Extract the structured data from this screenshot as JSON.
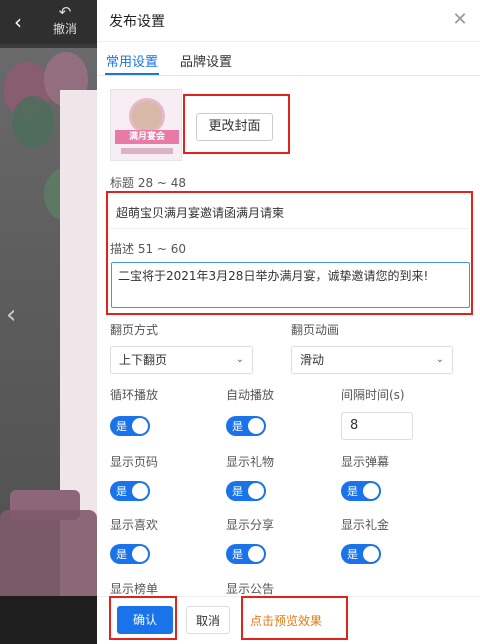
{
  "editor": {
    "undo_label": "撤消"
  },
  "panel": {
    "title": "发布设置",
    "tabs": [
      {
        "label": "常用设置",
        "active": true
      },
      {
        "label": "品牌设置",
        "active": false
      }
    ],
    "cover": {
      "banner_text": "满月宴会",
      "change_button": "更改封面"
    },
    "title_field": {
      "label": "标题 28 ~ 48",
      "value": "超萌宝贝满月宴邀请函满月请柬"
    },
    "desc_field": {
      "label": "描述 51 ~ 60",
      "value": "二宝将于2021年3月28日举办满月宴，诚挚邀请您的到来!"
    },
    "page_turn": {
      "mode_label": "翻页方式",
      "mode_value": "上下翻页",
      "anim_label": "翻页动画",
      "anim_value": "滑动"
    },
    "toggles": [
      {
        "label": "循环播放",
        "state": "是"
      },
      {
        "label": "自动播放",
        "state": "是"
      },
      {
        "label": "显示页码",
        "state": "是"
      },
      {
        "label": "显示礼物",
        "state": "是"
      },
      {
        "label": "显示弹幕",
        "state": "是"
      },
      {
        "label": "显示喜欢",
        "state": "是"
      },
      {
        "label": "显示分享",
        "state": "是"
      },
      {
        "label": "显示礼金",
        "state": "是"
      }
    ],
    "interval": {
      "label": "间隔时间(s)",
      "value": "8"
    },
    "more_labels": [
      "显示榜单",
      "显示公告"
    ],
    "footer": {
      "confirm": "确认",
      "cancel": "取消",
      "preview": "点击预览效果"
    }
  },
  "colors": {
    "accent": "#1a73e8",
    "highlight": "#e2231a",
    "preview": "#e37a12"
  }
}
